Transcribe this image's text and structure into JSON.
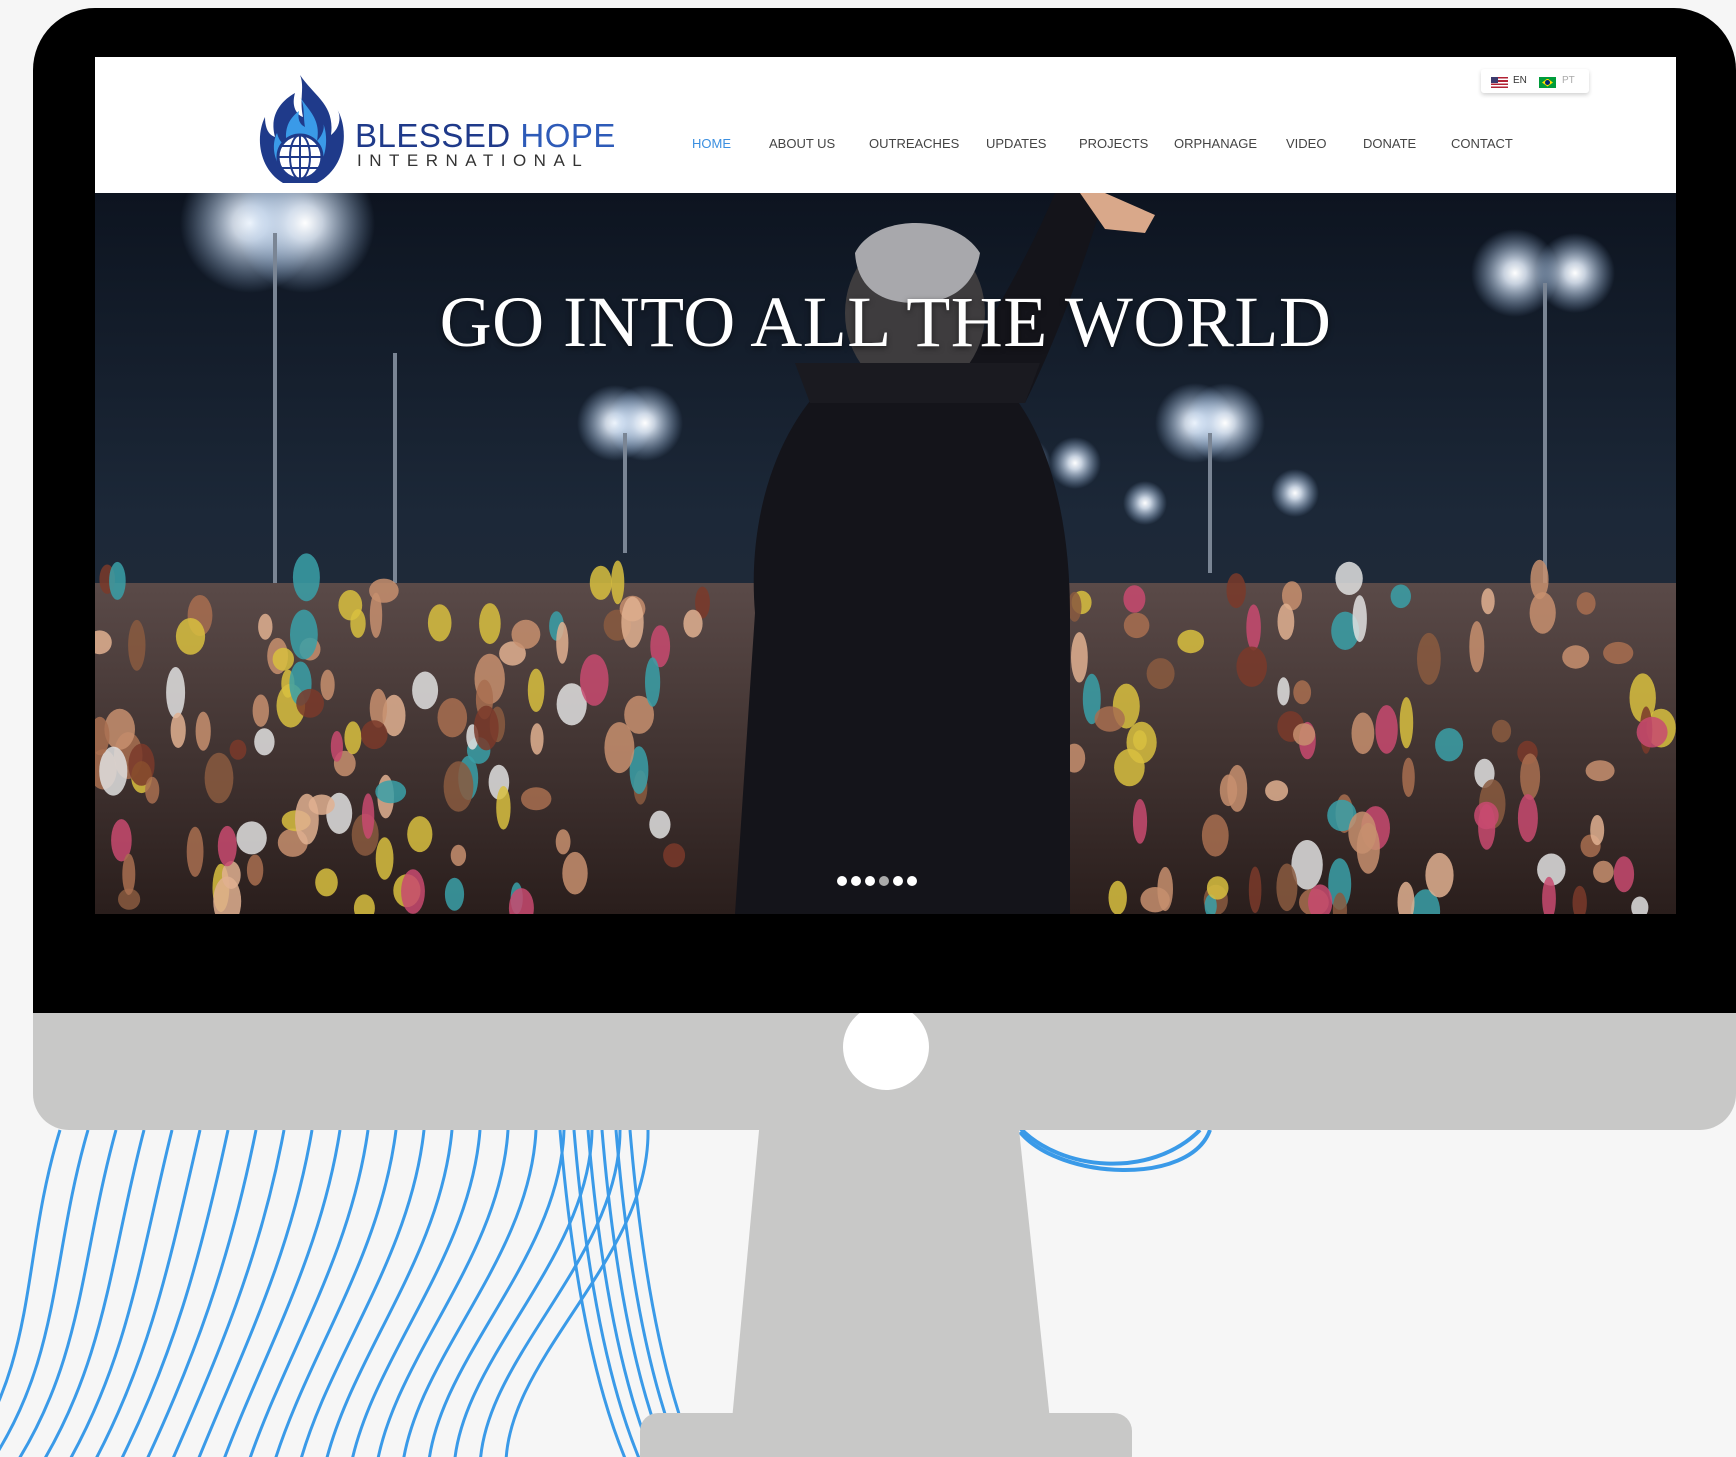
{
  "site": {
    "brand_name": "BLESSED",
    "brand_name_2": "HOPE",
    "brand_subtitle": "INTERNATIONAL"
  },
  "nav": {
    "items": [
      {
        "label": "HOME",
        "active": true
      },
      {
        "label": "ABOUT US"
      },
      {
        "label": "OUTREACHES"
      },
      {
        "label": "UPDATES"
      },
      {
        "label": "PROJECTS"
      },
      {
        "label": "ORPHANAGE"
      },
      {
        "label": "VIDEO"
      },
      {
        "label": "DONATE"
      },
      {
        "label": "CONTACT"
      }
    ]
  },
  "language": {
    "options": [
      {
        "code": "EN",
        "flag": "us-flag-icon",
        "selected": true
      },
      {
        "code": "PT",
        "flag": "brazil-flag-icon"
      }
    ]
  },
  "hero": {
    "title": "GO INTO ALL THE WORLD",
    "slides": 6,
    "current_slide": 4
  },
  "colors": {
    "accent": "#3b8fe0",
    "brand_navy": "#1f3a8a",
    "decor_lines": "#3a9ae8",
    "monitor_gray": "#c8c8c7"
  }
}
